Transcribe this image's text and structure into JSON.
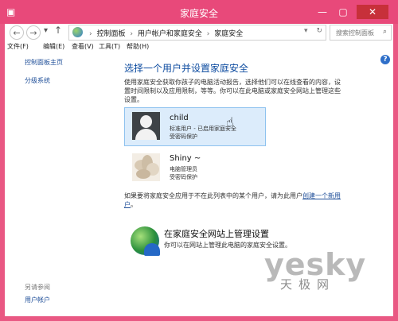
{
  "window": {
    "title": "家庭安全",
    "controls": {
      "minimize": "—",
      "maximize": "▢",
      "close": "✕"
    }
  },
  "nav": {
    "back": "←",
    "forward": "→",
    "dropdown": "▾",
    "up": "↑",
    "breadcrumb": [
      "控制面板",
      "用户帐户和家庭安全",
      "家庭安全"
    ],
    "refresh": "↻",
    "address_dropdown": "▾",
    "search_placeholder": "搜索控制面板"
  },
  "menu": [
    "文件(F)",
    "编辑(E)",
    "查看(V)",
    "工具(T)",
    "帮助(H)"
  ],
  "sidebar": {
    "items": [
      "控制面板主页",
      "分级系统"
    ],
    "see_also_label": "另请参阅",
    "see_also_items": [
      "用户帐户"
    ]
  },
  "main": {
    "heading": "选择一个用户并设置家庭安全",
    "description": "使用家庭安全获取你孩子的电脑活动报告，选择他们可以在线查看的内容，设置时间限制以及应用限制，等等。你可以在此电脑或家庭安全网站上管理这些设置。",
    "users": [
      {
        "name": "child",
        "role": "标准用户 - 已启用家庭安全",
        "status": "受密码保护",
        "selected": true
      },
      {
        "name": "Shiny ~",
        "role": "电脑管理员",
        "status": "受密码保护",
        "selected": false
      }
    ],
    "note_prefix": "如果要将家庭安全应用于不在此列表中的某个用户，请为此用户",
    "note_link": "创建一个新用户",
    "note_suffix": "。",
    "site": {
      "title": "在家庭安全网站上管理设置",
      "subtitle": "你可以在网站上管理此电脑的家庭安全设置。"
    }
  },
  "watermark": {
    "brand": "yesky",
    "sub": "天极网"
  },
  "colors": {
    "accent": "#e8497a",
    "link": "#1e4e98",
    "heading": "#0e4ca0",
    "selection": "#dcecfb"
  }
}
